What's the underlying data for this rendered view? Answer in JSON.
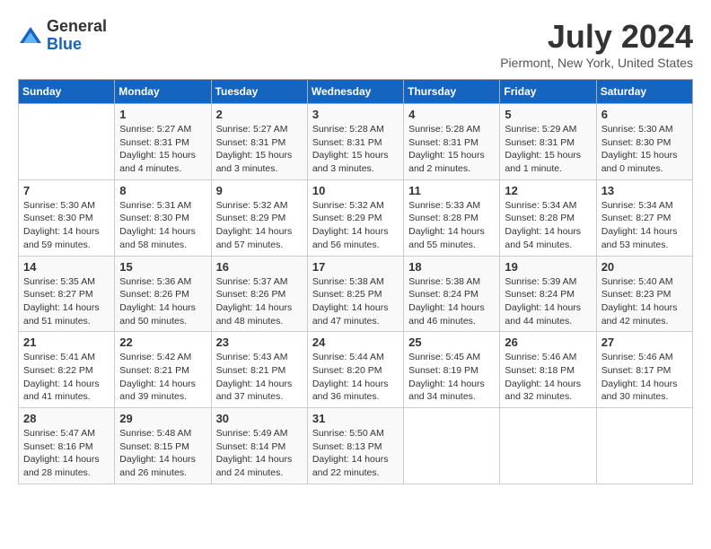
{
  "header": {
    "logo": {
      "general": "General",
      "blue": "Blue"
    },
    "title": "July 2024",
    "location": "Piermont, New York, United States"
  },
  "weekdays": [
    "Sunday",
    "Monday",
    "Tuesday",
    "Wednesday",
    "Thursday",
    "Friday",
    "Saturday"
  ],
  "weeks": [
    [
      {
        "day": "",
        "sunrise": "",
        "sunset": "",
        "daylight": ""
      },
      {
        "day": "1",
        "sunrise": "Sunrise: 5:27 AM",
        "sunset": "Sunset: 8:31 PM",
        "daylight": "Daylight: 15 hours and 4 minutes."
      },
      {
        "day": "2",
        "sunrise": "Sunrise: 5:27 AM",
        "sunset": "Sunset: 8:31 PM",
        "daylight": "Daylight: 15 hours and 3 minutes."
      },
      {
        "day": "3",
        "sunrise": "Sunrise: 5:28 AM",
        "sunset": "Sunset: 8:31 PM",
        "daylight": "Daylight: 15 hours and 3 minutes."
      },
      {
        "day": "4",
        "sunrise": "Sunrise: 5:28 AM",
        "sunset": "Sunset: 8:31 PM",
        "daylight": "Daylight: 15 hours and 2 minutes."
      },
      {
        "day": "5",
        "sunrise": "Sunrise: 5:29 AM",
        "sunset": "Sunset: 8:31 PM",
        "daylight": "Daylight: 15 hours and 1 minute."
      },
      {
        "day": "6",
        "sunrise": "Sunrise: 5:30 AM",
        "sunset": "Sunset: 8:30 PM",
        "daylight": "Daylight: 15 hours and 0 minutes."
      }
    ],
    [
      {
        "day": "7",
        "sunrise": "Sunrise: 5:30 AM",
        "sunset": "Sunset: 8:30 PM",
        "daylight": "Daylight: 14 hours and 59 minutes."
      },
      {
        "day": "8",
        "sunrise": "Sunrise: 5:31 AM",
        "sunset": "Sunset: 8:30 PM",
        "daylight": "Daylight: 14 hours and 58 minutes."
      },
      {
        "day": "9",
        "sunrise": "Sunrise: 5:32 AM",
        "sunset": "Sunset: 8:29 PM",
        "daylight": "Daylight: 14 hours and 57 minutes."
      },
      {
        "day": "10",
        "sunrise": "Sunrise: 5:32 AM",
        "sunset": "Sunset: 8:29 PM",
        "daylight": "Daylight: 14 hours and 56 minutes."
      },
      {
        "day": "11",
        "sunrise": "Sunrise: 5:33 AM",
        "sunset": "Sunset: 8:28 PM",
        "daylight": "Daylight: 14 hours and 55 minutes."
      },
      {
        "day": "12",
        "sunrise": "Sunrise: 5:34 AM",
        "sunset": "Sunset: 8:28 PM",
        "daylight": "Daylight: 14 hours and 54 minutes."
      },
      {
        "day": "13",
        "sunrise": "Sunrise: 5:34 AM",
        "sunset": "Sunset: 8:27 PM",
        "daylight": "Daylight: 14 hours and 53 minutes."
      }
    ],
    [
      {
        "day": "14",
        "sunrise": "Sunrise: 5:35 AM",
        "sunset": "Sunset: 8:27 PM",
        "daylight": "Daylight: 14 hours and 51 minutes."
      },
      {
        "day": "15",
        "sunrise": "Sunrise: 5:36 AM",
        "sunset": "Sunset: 8:26 PM",
        "daylight": "Daylight: 14 hours and 50 minutes."
      },
      {
        "day": "16",
        "sunrise": "Sunrise: 5:37 AM",
        "sunset": "Sunset: 8:26 PM",
        "daylight": "Daylight: 14 hours and 48 minutes."
      },
      {
        "day": "17",
        "sunrise": "Sunrise: 5:38 AM",
        "sunset": "Sunset: 8:25 PM",
        "daylight": "Daylight: 14 hours and 47 minutes."
      },
      {
        "day": "18",
        "sunrise": "Sunrise: 5:38 AM",
        "sunset": "Sunset: 8:24 PM",
        "daylight": "Daylight: 14 hours and 46 minutes."
      },
      {
        "day": "19",
        "sunrise": "Sunrise: 5:39 AM",
        "sunset": "Sunset: 8:24 PM",
        "daylight": "Daylight: 14 hours and 44 minutes."
      },
      {
        "day": "20",
        "sunrise": "Sunrise: 5:40 AM",
        "sunset": "Sunset: 8:23 PM",
        "daylight": "Daylight: 14 hours and 42 minutes."
      }
    ],
    [
      {
        "day": "21",
        "sunrise": "Sunrise: 5:41 AM",
        "sunset": "Sunset: 8:22 PM",
        "daylight": "Daylight: 14 hours and 41 minutes."
      },
      {
        "day": "22",
        "sunrise": "Sunrise: 5:42 AM",
        "sunset": "Sunset: 8:21 PM",
        "daylight": "Daylight: 14 hours and 39 minutes."
      },
      {
        "day": "23",
        "sunrise": "Sunrise: 5:43 AM",
        "sunset": "Sunset: 8:21 PM",
        "daylight": "Daylight: 14 hours and 37 minutes."
      },
      {
        "day": "24",
        "sunrise": "Sunrise: 5:44 AM",
        "sunset": "Sunset: 8:20 PM",
        "daylight": "Daylight: 14 hours and 36 minutes."
      },
      {
        "day": "25",
        "sunrise": "Sunrise: 5:45 AM",
        "sunset": "Sunset: 8:19 PM",
        "daylight": "Daylight: 14 hours and 34 minutes."
      },
      {
        "day": "26",
        "sunrise": "Sunrise: 5:46 AM",
        "sunset": "Sunset: 8:18 PM",
        "daylight": "Daylight: 14 hours and 32 minutes."
      },
      {
        "day": "27",
        "sunrise": "Sunrise: 5:46 AM",
        "sunset": "Sunset: 8:17 PM",
        "daylight": "Daylight: 14 hours and 30 minutes."
      }
    ],
    [
      {
        "day": "28",
        "sunrise": "Sunrise: 5:47 AM",
        "sunset": "Sunset: 8:16 PM",
        "daylight": "Daylight: 14 hours and 28 minutes."
      },
      {
        "day": "29",
        "sunrise": "Sunrise: 5:48 AM",
        "sunset": "Sunset: 8:15 PM",
        "daylight": "Daylight: 14 hours and 26 minutes."
      },
      {
        "day": "30",
        "sunrise": "Sunrise: 5:49 AM",
        "sunset": "Sunset: 8:14 PM",
        "daylight": "Daylight: 14 hours and 24 minutes."
      },
      {
        "day": "31",
        "sunrise": "Sunrise: 5:50 AM",
        "sunset": "Sunset: 8:13 PM",
        "daylight": "Daylight: 14 hours and 22 minutes."
      },
      {
        "day": "",
        "sunrise": "",
        "sunset": "",
        "daylight": ""
      },
      {
        "day": "",
        "sunrise": "",
        "sunset": "",
        "daylight": ""
      },
      {
        "day": "",
        "sunrise": "",
        "sunset": "",
        "daylight": ""
      }
    ]
  ]
}
